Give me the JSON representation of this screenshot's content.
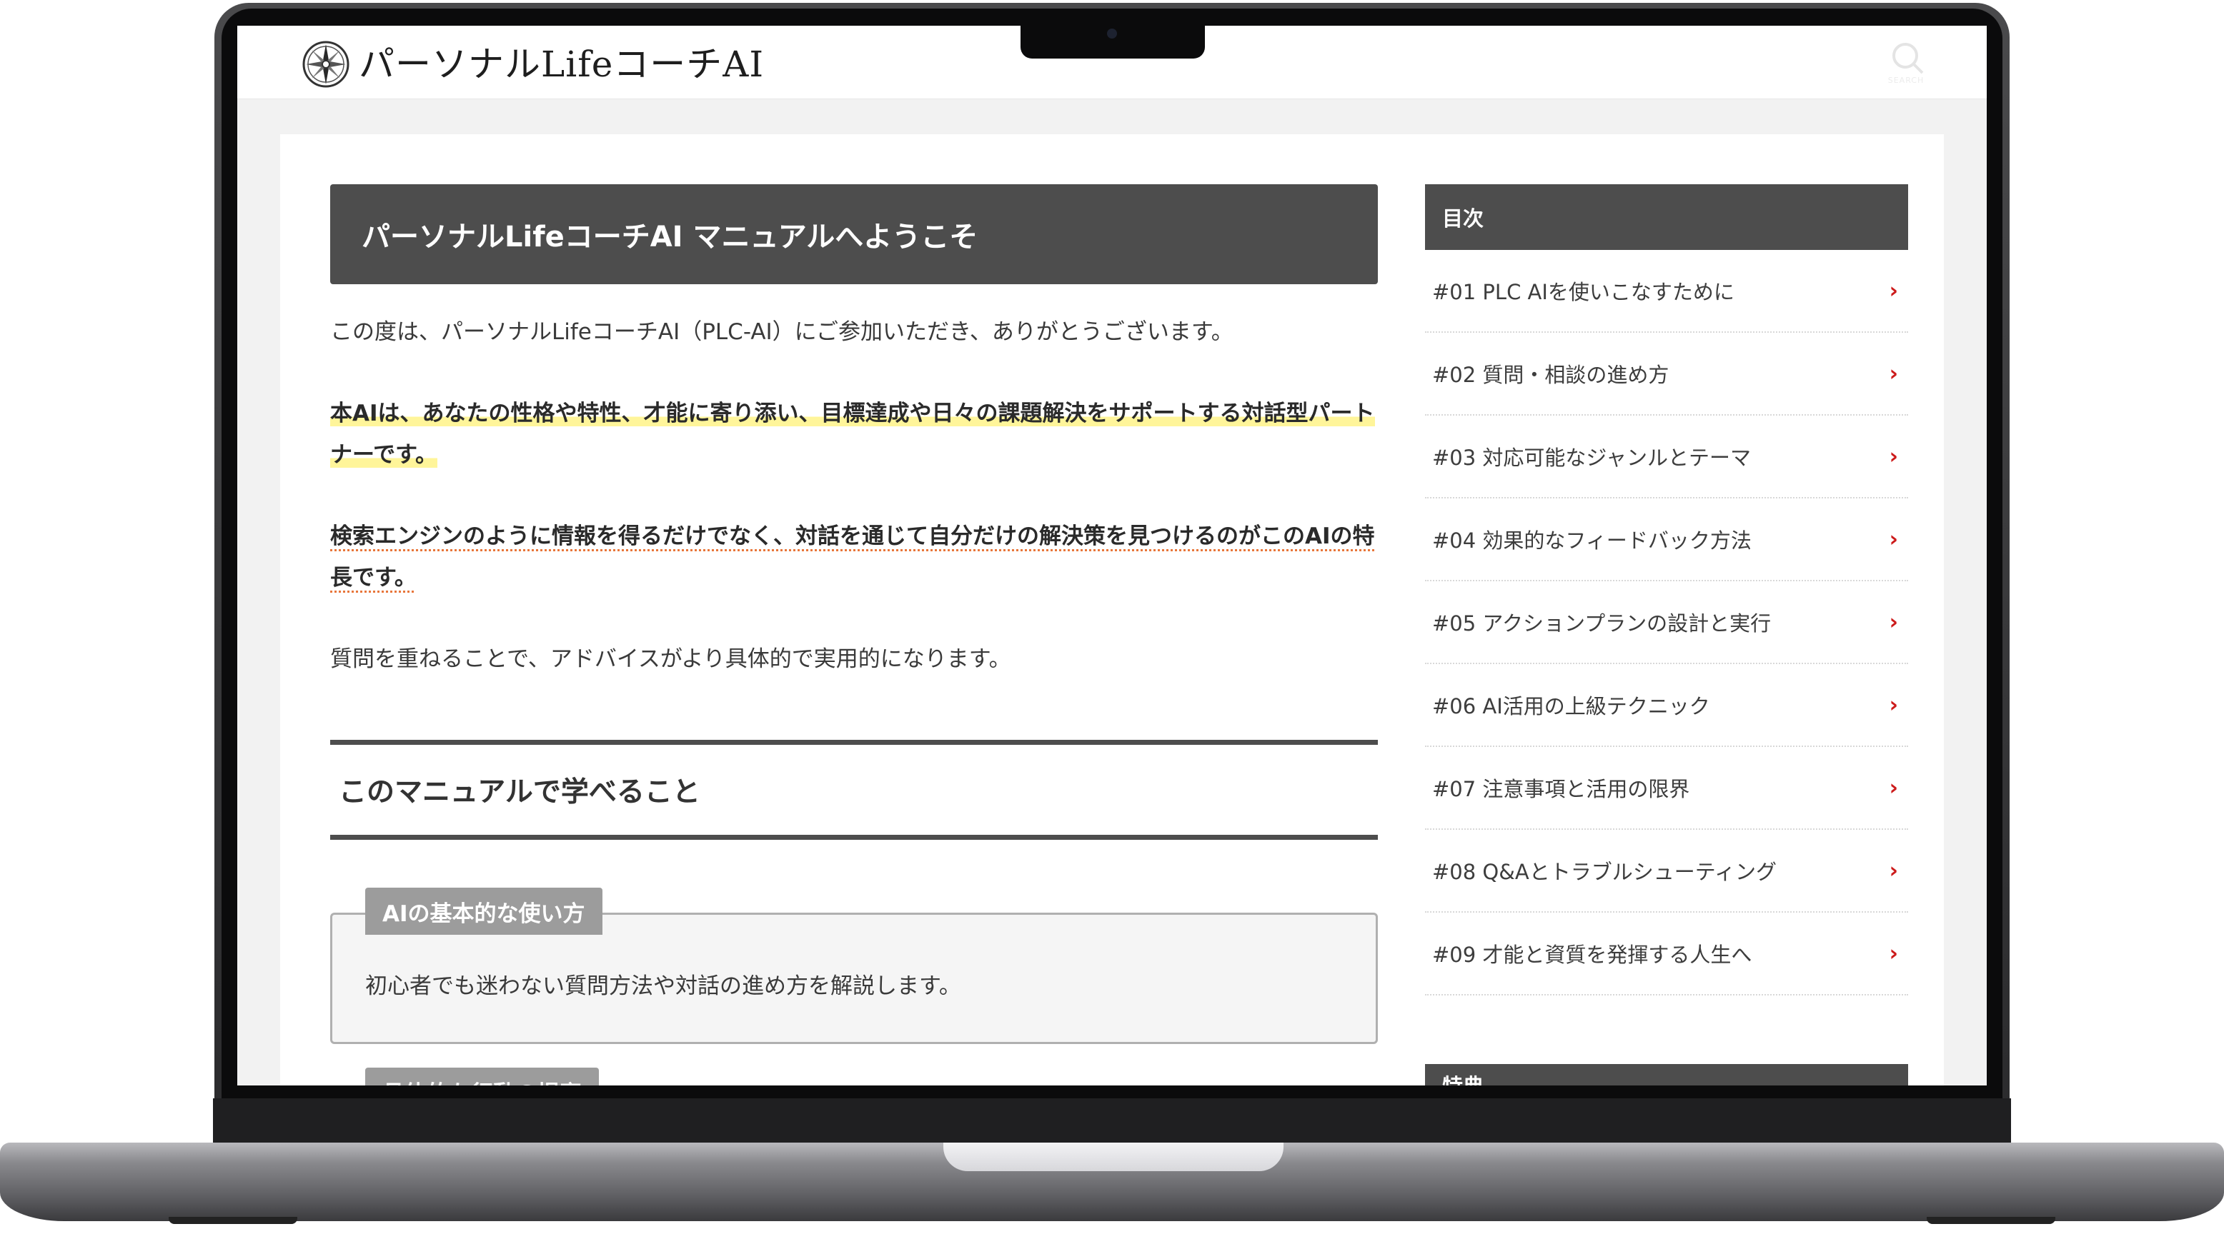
{
  "site": {
    "title": "パーソナルLifeコーチAI",
    "search_label": "SEARCH"
  },
  "main": {
    "heading": "パーソナルLifeコーチAI マニュアルへようこそ",
    "intro": "この度は、パーソナルLifeコーチAI（PLC-AI）にご参加いただき、ありがとうございます。",
    "highlight_1": "本AIは、あなたの性格や特性、才能に寄り添い、目標達成や日々の課題解決をサポートする対話型パートナーです。",
    "highlight_2": "検索エンジンのように情報を得るだけでなく、対話を通じて自分だけの解決策を見つけるのがこのAIの特長です。",
    "note": "質問を重ねることで、アドバイスがより具体的で実用的になります。",
    "section_title": "このマニュアルで学べること",
    "boxes": [
      {
        "label": "AIの基本的な使い方",
        "text": "初心者でも迷わない質問方法や対話の進め方を解説します。"
      },
      {
        "label": "具体的な行動の提案",
        "text": ""
      }
    ]
  },
  "sidebar": {
    "toc_title": "目次",
    "items": [
      "#01 PLC AIを使いこなすために",
      "#02 質問・相談の進め方",
      "#03 対応可能なジャンルとテーマ",
      "#04 効果的なフィードバック方法",
      "#05 アクションプランの設計と実行",
      "#06 AI活用の上級テクニック",
      "#07 注意事項と活用の限界",
      "#08 Q&Aとトラブルシューティング",
      "#09 才能と資質を発揮する人生へ"
    ],
    "next_widget_title": "特典"
  },
  "colors": {
    "heading_bg": "#4d4d4d",
    "chevron": "#cc1a1a",
    "marker": "#fff59a",
    "underline": "#e8763a"
  },
  "icons": {
    "logo": "compass-icon",
    "search": "search-icon",
    "chevron": "chevron-right-icon"
  }
}
